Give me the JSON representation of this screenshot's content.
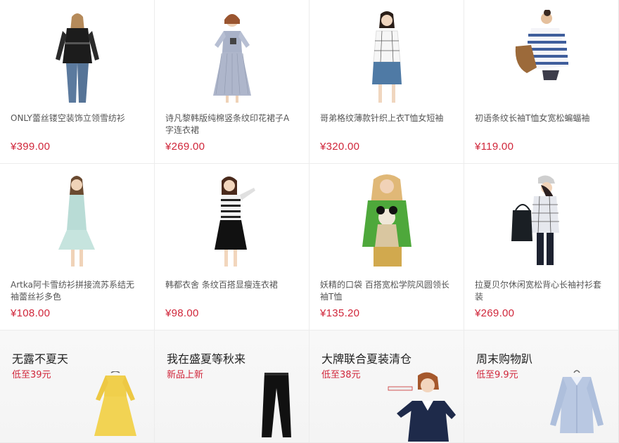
{
  "products": [
    {
      "name": "ONLY蕾丝镂空装饰立领雪纺衫",
      "price": "¥399.00",
      "icon": "black-lace-blouse"
    },
    {
      "name": "诗凡黎韩版纯棉竖条纹印花裙子A字连衣裙",
      "price": "¥269.00",
      "icon": "striped-dress"
    },
    {
      "name": "哥弟格纹薄款针织上衣T恤女短袖",
      "price": "¥320.00",
      "icon": "plaid-knit-top"
    },
    {
      "name": "初语条纹长袖T恤女宽松蝙蝠袖",
      "price": "¥119.00",
      "icon": "striped-batwing-tee"
    },
    {
      "name": "Artka阿卡雪纺衫拼接流苏系结无袖蕾丝衫多色",
      "price": "¥108.00",
      "icon": "mint-chiffon-top"
    },
    {
      "name": "韩都衣舍 条纹百搭显瘦连衣裙",
      "price": "¥98.00",
      "icon": "striped-suspender-dress"
    },
    {
      "name": "妖精的口袋 百搭宽松学院风圆领长袖T恤",
      "price": "¥135.20",
      "icon": "green-print-sweater"
    },
    {
      "name": "拉夏贝尔休闲宽松背心长袖衬衫套装",
      "price": "¥269.00",
      "icon": "plaid-shirt-set"
    }
  ],
  "promos": [
    {
      "title": "无露不夏天",
      "subtitle": "低至39元",
      "icon": "yellow-dress"
    },
    {
      "title": "我在盛夏等秋来",
      "subtitle": "新品上新",
      "icon": "black-pants"
    },
    {
      "title": "大牌联合夏装清仓",
      "subtitle": "低至38元",
      "icon": "navy-polo-model"
    },
    {
      "title": "周末购物趴",
      "subtitle": "低至9.9元",
      "icon": "blue-shirt"
    }
  ],
  "colors": {
    "price": "#d0263a",
    "promo_subtitle": "#d0263a",
    "border": "#ececec"
  }
}
